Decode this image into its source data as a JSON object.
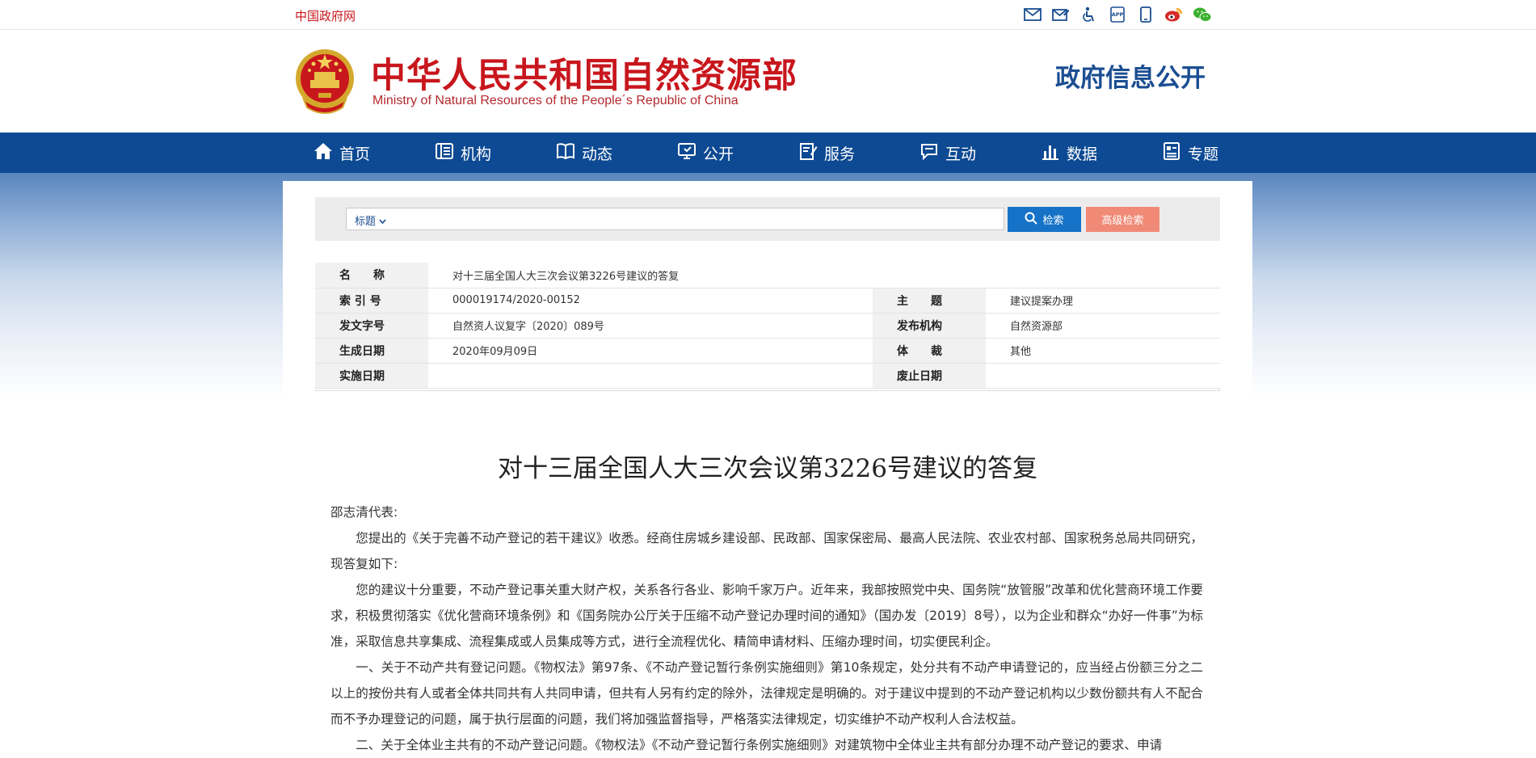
{
  "topbar": {
    "gov_link": "中国政府网",
    "icons": [
      "mail-icon",
      "mail-edit-icon",
      "accessibility-icon",
      "app-icon",
      "mobile-icon",
      "weibo-icon",
      "wechat-icon"
    ]
  },
  "header": {
    "title": "中华人民共和国自然资源部",
    "subtitle": "Ministry of Natural Resources of the People´s Republic of China",
    "gov_info": "政府信息公开"
  },
  "nav": {
    "items": [
      {
        "label": "首页",
        "icon": "home-icon"
      },
      {
        "label": "机构",
        "icon": "org-icon"
      },
      {
        "label": "动态",
        "icon": "book-icon"
      },
      {
        "label": "公开",
        "icon": "monitor-icon"
      },
      {
        "label": "服务",
        "icon": "edit-icon"
      },
      {
        "label": "互动",
        "icon": "chat-icon"
      },
      {
        "label": "数据",
        "icon": "chart-icon"
      },
      {
        "label": "专题",
        "icon": "list-icon"
      }
    ]
  },
  "search": {
    "type_label": "标题",
    "value": "",
    "search_label": "检索",
    "advanced_label": "高级检索"
  },
  "meta": {
    "name_label": "名　　称",
    "name_value": "对十三届全国人大三次会议第3226号建议的答复",
    "index_label": "索 引 号",
    "index_value": "000019174/2020-00152",
    "topic_label": "主　　题",
    "topic_value": "建议提案办理",
    "docno_label": "发文字号",
    "docno_value": "自然资人议复字〔2020〕089号",
    "publisher_label": "发布机构",
    "publisher_value": "自然资源部",
    "date_label": "生成日期",
    "date_value": "2020年09月09日",
    "genre_label": "体　　裁",
    "genre_value": "其他",
    "effective_label": "实施日期",
    "effective_value": "",
    "expire_label": "废止日期",
    "expire_value": ""
  },
  "document": {
    "title": "对十三届全国人大三次会议第3226号建议的答复",
    "salutation": "邵志清代表:",
    "paragraphs": [
      "您提出的《关于完善不动产登记的若干建议》收悉。经商住房城乡建设部、民政部、国家保密局、最高人民法院、农业农村部、国家税务总局共同研究，现答复如下:",
      "您的建议十分重要，不动产登记事关重大财产权，关系各行各业、影响千家万户。近年来，我部按照党中央、国务院“放管服”改革和优化营商环境工作要求，积极贯彻落实《优化营商环境条例》和《国务院办公厅关于压缩不动产登记办理时间的通知》（国办发〔2019〕8号），以为企业和群众“办好一件事”为标准，采取信息共享集成、流程集成或人员集成等方式，进行全流程优化、精简申请材料、压缩办理时间，切实便民利企。",
      "一、关于不动产共有登记问题。《物权法》第97条、《不动产登记暂行条例实施细则》第10条规定，处分共有不动产申请登记的，应当经占份额三分之二以上的按份共有人或者全体共同共有人共同申请，但共有人另有约定的除外，法律规定是明确的。对于建议中提到的不动产登记机构以少数份额共有人不配合而不予办理登记的问题，属于执行层面的问题，我们将加强监督指导，严格落实法律规定，切实维护不动产权利人合法权益。",
      "二、关于全体业主共有的不动产登记问题。《物权法》《不动产登记暂行条例实施细则》对建筑物中全体业主共有部分办理不动产登记的要求、申请"
    ]
  },
  "colors": {
    "brand_red": "#c8161d",
    "nav_blue": "#0e4a93",
    "search_blue": "#1572c7",
    "advanced_salmon": "#f08a77"
  }
}
